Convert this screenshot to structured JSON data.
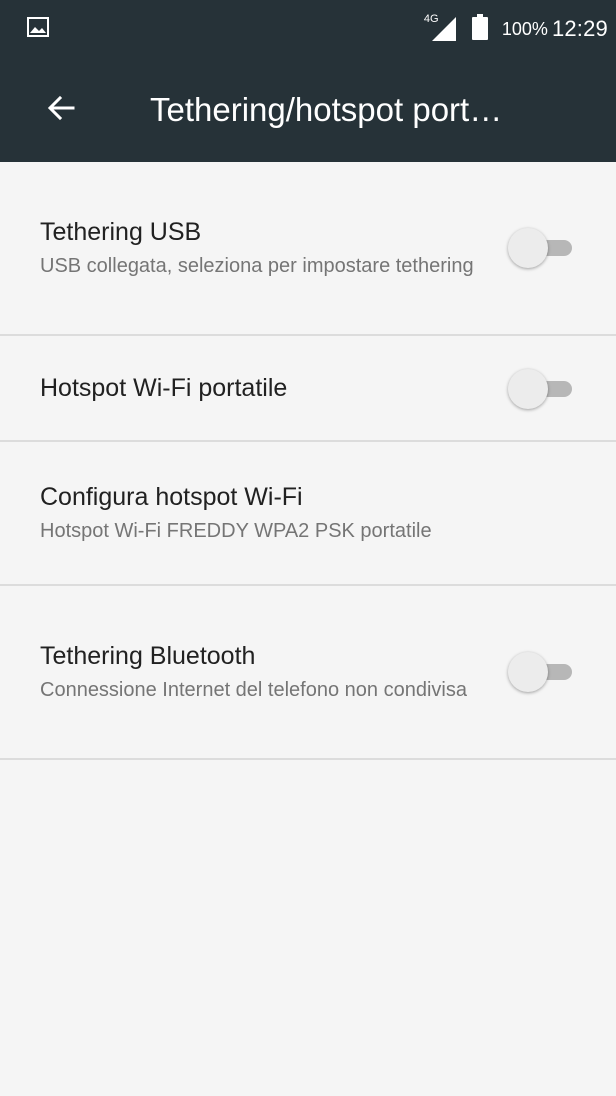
{
  "status_bar": {
    "network_label": "4G",
    "battery_percent": "100%",
    "time": "12:29",
    "left_icon": "gallery-notification-icon"
  },
  "toolbar": {
    "back_icon": "arrow-back-icon",
    "title": "Tethering/hotspot port…"
  },
  "settings": [
    {
      "title": "Tethering USB",
      "summary": "USB collegata, seleziona per impostare tethering",
      "toggle_on": false
    },
    {
      "title": "Hotspot Wi-Fi portatile",
      "summary": "",
      "toggle_on": false
    },
    {
      "title": "Configura hotspot Wi-Fi",
      "summary": "Hotspot Wi-Fi FREDDY WPA2 PSK portatile"
    },
    {
      "title": "Tethering Bluetooth",
      "summary": "Connessione Internet del telefono non condivisa",
      "toggle_on": false
    }
  ],
  "colors": {
    "app_bar": "#263238",
    "background": "#f5f5f5",
    "switch_thumb_off": "#ececec",
    "switch_track_off": "#b7b7b7"
  }
}
